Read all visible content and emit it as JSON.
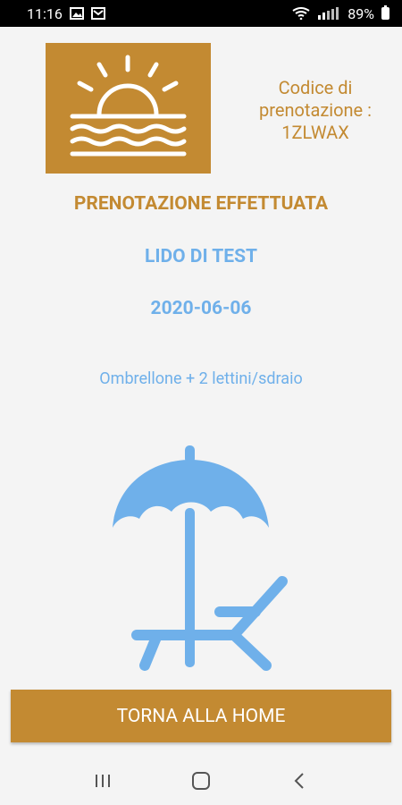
{
  "status_bar": {
    "time": "11:16",
    "battery": "89%"
  },
  "booking": {
    "code_label": "Codice di prenotazione :",
    "code_value": "1ZLWAX",
    "title": "PRENOTAZIONE EFFETTUATA",
    "lido_name": "LIDO DI TEST",
    "date": "2020-06-06",
    "service": "Ombrellone + 2 lettini/sdraio"
  },
  "actions": {
    "home_label": "TORNA ALLA HOME"
  },
  "colors": {
    "brand_gold": "#c38a32",
    "accent_blue": "#6fb0ea",
    "background": "#f4f4f4"
  },
  "icons": {
    "logo": "sunset-sea-icon",
    "illustration": "beach-umbrella-lounger-icon"
  }
}
